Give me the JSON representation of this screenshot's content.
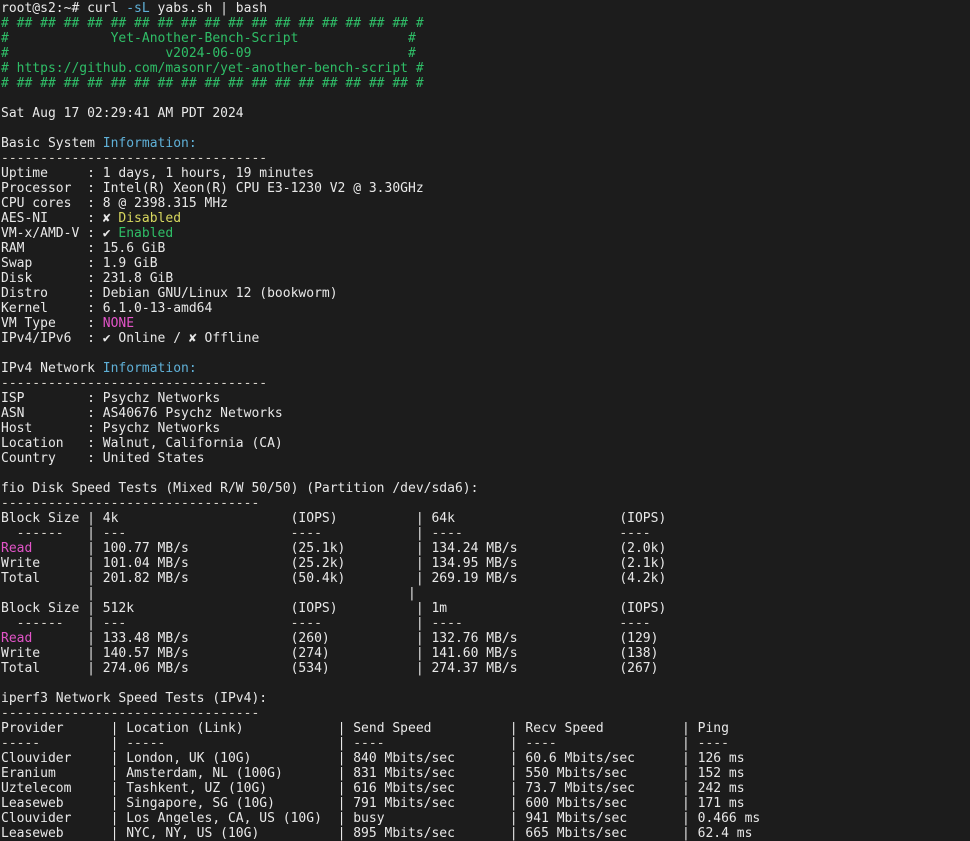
{
  "terminal": {
    "background": "#1c1c1c",
    "foreground": "#e8e8e8",
    "accent_green": "#2fbe67",
    "accent_cyan": "#5fb0d7",
    "accent_yellow": "#d7d75f",
    "accent_magenta": "#e254c8"
  },
  "prompt": {
    "user_host": "root@s2:~# ",
    "command_head": "curl ",
    "command_flag": "-sL",
    "command_tail": " yabs.sh | bash"
  },
  "banner": {
    "rule": "# ## ## ## ## ## ## ## ## ## ## ## ## ## ## ## ## ## #",
    "line_title_left": "#",
    "title": "Yet-Another-Bench-Script",
    "line_title_right": "#",
    "version": "v2024-06-09",
    "url": "# https://github.com/masonr/yet-another-bench-script #"
  },
  "timestamp": "Sat Aug 17 02:29:41 AM PDT 2024",
  "basic_system": {
    "heading_plain": "Basic System ",
    "heading_accent": "Information:",
    "separator": "----------------------------------",
    "rows": [
      {
        "label": "Uptime",
        "value": "1 days, 1 hours, 19 minutes"
      },
      {
        "label": "Processor",
        "value": "Intel(R) Xeon(R) CPU E3-1230 V2 @ 3.30GHz"
      },
      {
        "label": "CPU cores",
        "value": "8 @ 2398.315 MHz"
      },
      {
        "label": "AES-NI",
        "symbol": "✘",
        "value": "Disabled",
        "value_color": "c-yellow"
      },
      {
        "label": "VM-x/AMD-V",
        "symbol": "✔",
        "value": "Enabled",
        "value_color": "c-green"
      },
      {
        "label": "RAM",
        "value": "15.6 GiB"
      },
      {
        "label": "Swap",
        "value": "1.9 GiB"
      },
      {
        "label": "Disk",
        "value": "231.8 GiB"
      },
      {
        "label": "Distro",
        "value": "Debian GNU/Linux 12 (bookworm)"
      },
      {
        "label": "Kernel",
        "value": "6.1.0-13-amd64"
      },
      {
        "label": "VM Type",
        "value": "NONE",
        "value_color": "c-magenta"
      },
      {
        "label": "IPv4/IPv6",
        "value": "✔ Online / ✘ Offline"
      }
    ]
  },
  "ipv4_network": {
    "heading_plain": "IPv4 Network ",
    "heading_accent": "Information:",
    "separator": "----------------------------------",
    "rows": [
      {
        "label": "ISP",
        "value": "Psychz Networks"
      },
      {
        "label": "ASN",
        "value": "AS40676 Psychz Networks"
      },
      {
        "label": "Host",
        "value": "Psychz Networks"
      },
      {
        "label": "Location",
        "value": "Walnut, California (CA)"
      },
      {
        "label": "Country",
        "value": "United States"
      }
    ]
  },
  "fio_disk": {
    "heading": "fio Disk Speed Tests (Mixed R/W 50/50) (Partition /dev/sda6):",
    "separator": "---------------------------------",
    "blocks": [
      {
        "header_label": "Block Size",
        "col1_size": "4k",
        "col1_iops": "(IOPS)",
        "col2_size": "64k",
        "col2_iops": "(IOPS)",
        "dash_label": "------",
        "dash_col1_size": "---",
        "dash_col1_iops": "----",
        "dash_col2_size": "----",
        "dash_col2_iops": "----",
        "rows": [
          {
            "label": "Read",
            "label_color": "c-magenta",
            "c1_speed": "100.77 MB/s",
            "c1_iops": "(25.1k)",
            "c2_speed": "134.24 MB/s",
            "c2_iops": "(2.0k)"
          },
          {
            "label": "Write",
            "label_color": "c-white",
            "c1_speed": "101.04 MB/s",
            "c1_iops": "(25.2k)",
            "c2_speed": "134.95 MB/s",
            "c2_iops": "(2.1k)"
          },
          {
            "label": "Total",
            "label_color": "c-white",
            "c1_speed": "201.82 MB/s",
            "c1_iops": "(50.4k)",
            "c2_speed": "269.19 MB/s",
            "c2_iops": "(4.2k)"
          }
        ]
      },
      {
        "header_label": "Block Size",
        "col1_size": "512k",
        "col1_iops": "(IOPS)",
        "col2_size": "1m",
        "col2_iops": "(IOPS)",
        "dash_label": "------",
        "dash_col1_size": "---",
        "dash_col1_iops": "----",
        "dash_col2_size": "----",
        "dash_col2_iops": "----",
        "rows": [
          {
            "label": "Read",
            "label_color": "c-magenta",
            "c1_speed": "133.48 MB/s",
            "c1_iops": "(260)",
            "c2_speed": "132.76 MB/s",
            "c2_iops": "(129)"
          },
          {
            "label": "Write",
            "label_color": "c-white",
            "c1_speed": "140.57 MB/s",
            "c1_iops": "(274)",
            "c2_speed": "141.60 MB/s",
            "c2_iops": "(138)"
          },
          {
            "label": "Total",
            "label_color": "c-white",
            "c1_speed": "274.06 MB/s",
            "c1_iops": "(534)",
            "c2_speed": "274.37 MB/s",
            "c2_iops": "(267)"
          }
        ]
      }
    ]
  },
  "iperf3": {
    "heading": "iperf3 Network Speed Tests (IPv4):",
    "separator": "---------------------------------",
    "columns": {
      "provider": "Provider",
      "location": "Location (Link)",
      "send": "Send Speed",
      "recv": "Recv Speed",
      "ping": "Ping"
    },
    "dashes": {
      "provider": "-----",
      "location": "-----",
      "send": "----",
      "recv": "----",
      "ping": "----"
    },
    "rows": [
      {
        "provider": "Clouvider",
        "location": "London, UK (10G)",
        "send": "840 Mbits/sec",
        "recv": "60.6 Mbits/sec",
        "ping": "126 ms"
      },
      {
        "provider": "Eranium",
        "location": "Amsterdam, NL (100G)",
        "send": "831 Mbits/sec",
        "recv": "550 Mbits/sec",
        "ping": "152 ms"
      },
      {
        "provider": "Uztelecom",
        "location": "Tashkent, UZ (10G)",
        "send": "616 Mbits/sec",
        "recv": "73.7 Mbits/sec",
        "ping": "242 ms"
      },
      {
        "provider": "Leaseweb",
        "location": "Singapore, SG (10G)",
        "send": "791 Mbits/sec",
        "recv": "600 Mbits/sec",
        "ping": "171 ms"
      },
      {
        "provider": "Clouvider",
        "location": "Los Angeles, CA, US (10G)",
        "send": "busy",
        "recv": "941 Mbits/sec",
        "ping": "0.466 ms"
      },
      {
        "provider": "Leaseweb",
        "location": "NYC, NY, US (10G)",
        "send": "895 Mbits/sec",
        "recv": "665 Mbits/sec",
        "ping": "62.4 ms"
      }
    ]
  }
}
